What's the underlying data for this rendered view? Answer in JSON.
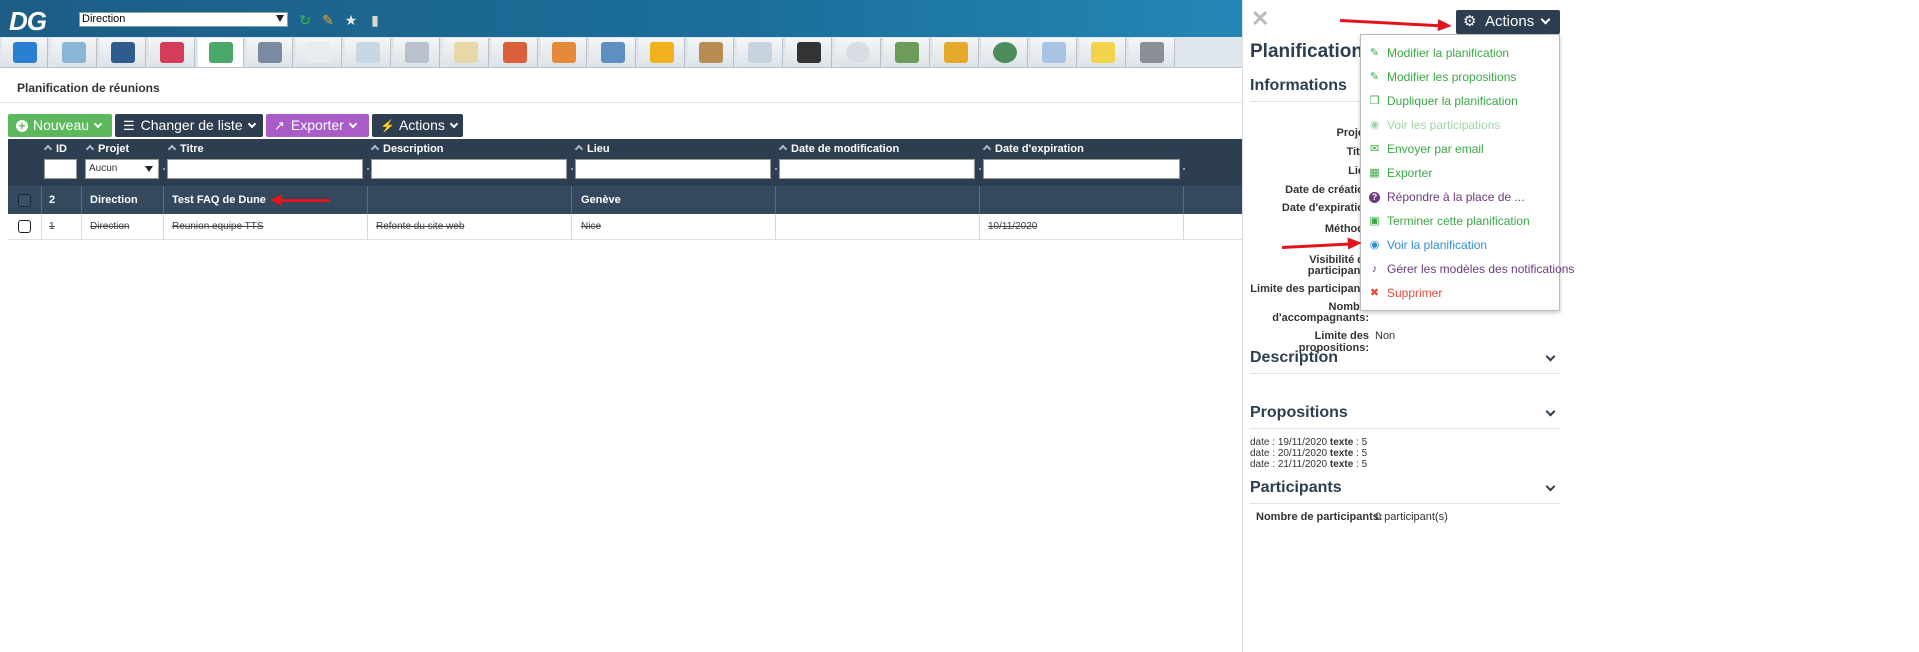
{
  "topbar": {
    "logo": "DG",
    "selector_value": "Direction"
  },
  "page": {
    "title": "Planification de réunions"
  },
  "toolbar": {
    "nouveau": "Nouveau",
    "changer_liste": "Changer de liste",
    "exporter": "Exporter",
    "actions": "Actions"
  },
  "table": {
    "columns": [
      "ID",
      "Projet",
      "Titre",
      "Description",
      "Lieu",
      "Date de modification",
      "Date d'expiration"
    ],
    "projet_filter": "Aucun",
    "rows": [
      {
        "id": "2",
        "projet": "Direction",
        "titre": "Test FAQ de Dune",
        "description": "",
        "lieu": "Genève",
        "modification": "",
        "expiration": ""
      },
      {
        "id": "1",
        "projet": "Direction",
        "titre": "Reunion equipe TTS",
        "description": "Refonte du site web",
        "lieu": "Nice",
        "modification": "",
        "expiration": "10/11/2020"
      }
    ]
  },
  "panel": {
    "title": "Planification",
    "actions_label": "Actions",
    "sections": {
      "informations": "Informations",
      "description": "Description",
      "propositions": "Propositions",
      "participants": "Participants"
    },
    "info_labels": {
      "id": "I",
      "projet": "Proje",
      "titre": "Titr",
      "lieu": "Lie",
      "date_creation": "Date de créatio",
      "date_expiration": "Date d'expiratio",
      "methode": "Méthod",
      "visibilite_1": "Visibilité d",
      "visibilite_2": "participant",
      "limite_participants": "Limite des participant",
      "nombre_1": "Nombr",
      "nombre_2": "d'accompagnants:",
      "limite_propositions": "Limite des propositions:"
    },
    "limite_propositions_value": "Non",
    "propositions": [
      {
        "date": "19/11/2020",
        "texte": "5"
      },
      {
        "date": "20/11/2020",
        "texte": "5"
      },
      {
        "date": "21/11/2020",
        "texte": "5"
      }
    ],
    "prop_date_label": "date",
    "prop_texte_label": "texte",
    "nb_participants_label": "Nombre de participants:",
    "nb_participants_value": "0 participant(s)"
  },
  "dropdown": {
    "items": [
      {
        "label": "Modifier la planification",
        "icon": "pencil-icon",
        "color": "#3aa845"
      },
      {
        "label": "Modifier les propositions",
        "icon": "pencil-icon",
        "color": "#3aa845"
      },
      {
        "label": "Dupliquer la planification",
        "icon": "copy-icon",
        "color": "#3aa845"
      },
      {
        "label": "Voir les participations",
        "icon": "eye-icon",
        "color": "#9fd3a4"
      },
      {
        "label": "Envoyer par email",
        "icon": "email-icon",
        "color": "#3aa845"
      },
      {
        "label": "Exporter",
        "icon": "table-icon",
        "color": "#3aa845"
      },
      {
        "label": "Répondre à la place de ...",
        "icon": "question-icon",
        "color": "#6d3a7e"
      },
      {
        "label": "Terminer cette planification",
        "icon": "lock-icon",
        "color": "#3aa845"
      },
      {
        "label": "Voir la planification",
        "icon": "eye-icon",
        "color": "#2f8fd1"
      },
      {
        "label": "Gérer les modèles des notifications",
        "icon": "bell-icon",
        "color": "#6d3a7e"
      },
      {
        "label": "Supprimer",
        "icon": "trash-icon",
        "color": "#e04b3a"
      }
    ]
  },
  "colors": {
    "header_dark": "#2c3e50",
    "green": "#5cb85c",
    "purple": "#a95cc7",
    "arrow": "#e0141a"
  }
}
